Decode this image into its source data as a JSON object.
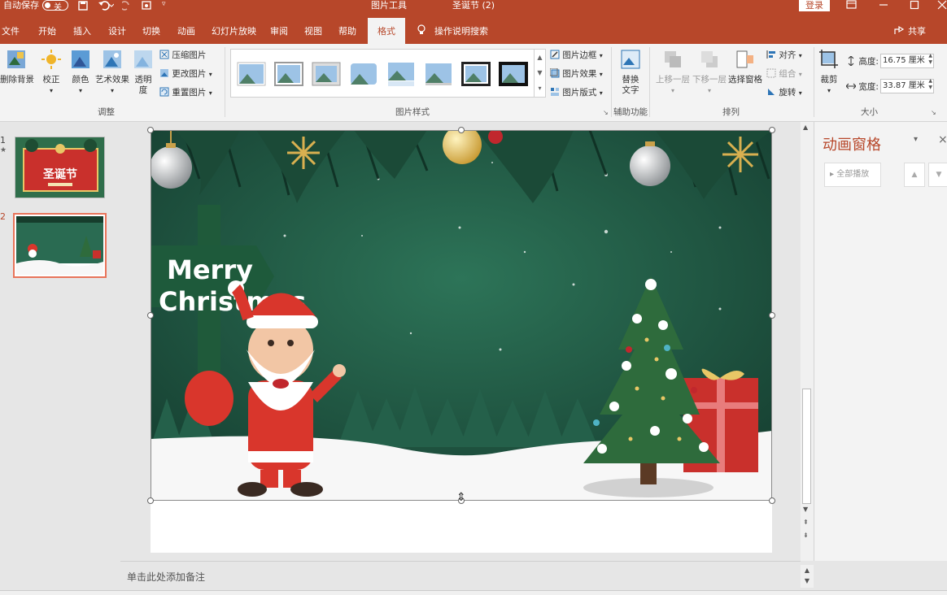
{
  "titlebar": {
    "autosave_label": "自动保存",
    "autosave_state": "关",
    "context_tool": "图片工具",
    "doc_title": "圣诞节 (2)",
    "login": "登录"
  },
  "tabs": [
    "文件",
    "开始",
    "插入",
    "设计",
    "切换",
    "动画",
    "幻灯片放映",
    "审阅",
    "视图",
    "帮助",
    "格式"
  ],
  "active_tab": "格式",
  "tell_me": "操作说明搜索",
  "share": "共享",
  "ribbon": {
    "adjust": {
      "remove_bg": "删除背景",
      "correct": "校正",
      "color": "颜色",
      "artistic": "艺术效果",
      "transparency_1": "透明",
      "transparency_2": "度",
      "compress": "压缩图片",
      "change": "更改图片",
      "reset": "重置图片",
      "label": "调整"
    },
    "styles": {
      "border": "图片边框",
      "effects": "图片效果",
      "layout": "图片版式",
      "label": "图片样式"
    },
    "accessibility": {
      "alt_1": "替换",
      "alt_2": "文字",
      "label": "辅助功能"
    },
    "arrange": {
      "bring_forward": "上移一层",
      "send_backward": "下移一层",
      "selection_pane": "选择窗格",
      "align": "对齐",
      "group": "组合",
      "rotate": "旋转",
      "label": "排列"
    },
    "size": {
      "crop": "裁剪",
      "height_label": "高度:",
      "height_value": "16.75 厘米",
      "width_label": "宽度:",
      "width_value": "33.87 厘米",
      "label": "大小"
    }
  },
  "slides": [
    {
      "number": "1",
      "title_art": "圣诞节"
    },
    {
      "number": "2"
    }
  ],
  "slide": {
    "sign_line1": "Merry",
    "sign_line2": "Christmas"
  },
  "anim_pane": {
    "title": "动画窗格",
    "play_all": "全部播放"
  },
  "notes_placeholder": "单击此处添加备注",
  "colors": {
    "accent": "#b7472a",
    "slide_bg": "#1f5a45",
    "snow": "#f7f7f7"
  }
}
